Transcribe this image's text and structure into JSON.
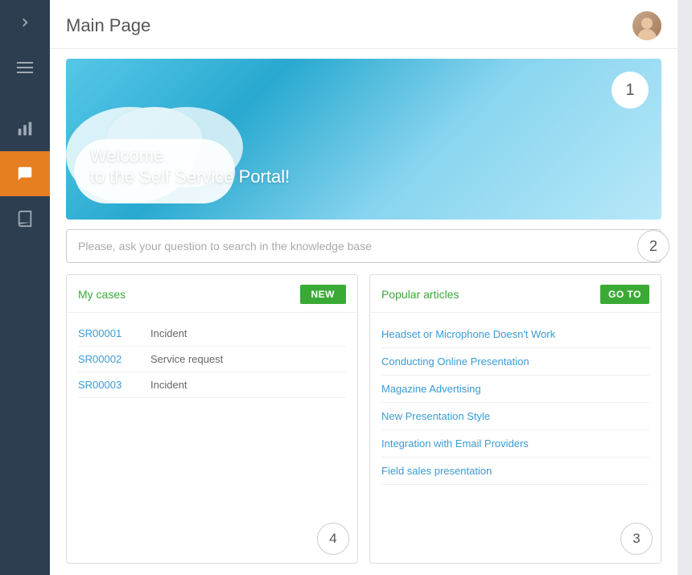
{
  "sidebar": {
    "toggle_label": "›",
    "items": [
      {
        "id": "chevron",
        "icon": "chevron-right",
        "active": false
      },
      {
        "id": "menu",
        "icon": "menu",
        "active": false
      },
      {
        "id": "chart",
        "icon": "chart",
        "active": false
      },
      {
        "id": "chat",
        "icon": "chat",
        "active": true
      },
      {
        "id": "book",
        "icon": "book",
        "active": false
      }
    ]
  },
  "header": {
    "title": "Main Page"
  },
  "hero": {
    "line1": "Welcome",
    "line2": "to the Self Service Portal!",
    "step": "1"
  },
  "search": {
    "placeholder": "Please, ask your question to search in the knowledge base",
    "kb_link_text": "knowledge base",
    "step": "2"
  },
  "my_cases": {
    "title": "My cases",
    "new_button": "NEW",
    "step": "4",
    "cases": [
      {
        "id": "SR00001",
        "type": "Incident"
      },
      {
        "id": "SR00002",
        "type": "Service request"
      },
      {
        "id": "SR00003",
        "type": "Incident"
      }
    ]
  },
  "popular_articles": {
    "title": "Popular articles",
    "goto_button": "GO TO",
    "step": "3",
    "articles": [
      {
        "title": "Headset or Microphone Doesn't Work"
      },
      {
        "title": "Conducting Online Presentation"
      },
      {
        "title": "Magazine Advertising"
      },
      {
        "title": "New Presentation Style"
      },
      {
        "title": "Integration with Email Providers"
      },
      {
        "title": "Field sales presentation"
      }
    ]
  }
}
